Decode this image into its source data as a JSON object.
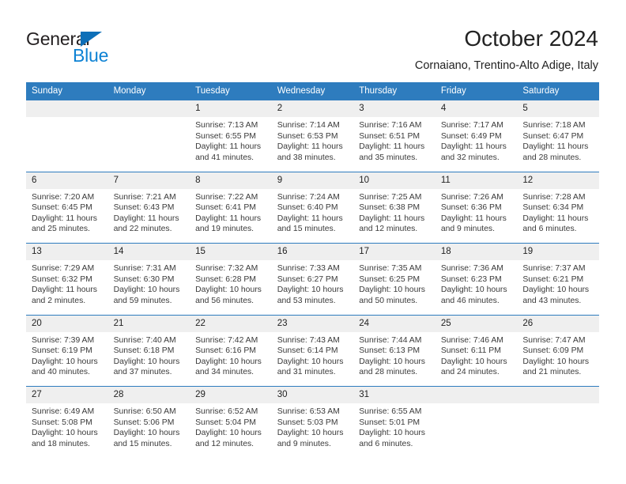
{
  "brand": {
    "name_part1": "General",
    "name_part2": "Blue",
    "accent_color": "#0d82d4",
    "triangle_color": "#0d6fb8"
  },
  "header": {
    "title": "October 2024",
    "subtitle": "Cornaiano, Trentino-Alto Adige, Italy",
    "header_bg": "#2e7cbe",
    "daynum_bg": "#efefef"
  },
  "weekday_headers": [
    "Sunday",
    "Monday",
    "Tuesday",
    "Wednesday",
    "Thursday",
    "Friday",
    "Saturday"
  ],
  "labels": {
    "sunrise_prefix": "Sunrise:",
    "sunset_prefix": "Sunset:",
    "daylight_prefix": "Daylight:"
  },
  "weeks": [
    [
      {
        "day": "",
        "empty": true
      },
      {
        "day": "",
        "empty": true
      },
      {
        "day": "1",
        "sunrise": "Sunrise: 7:13 AM",
        "sunset": "Sunset: 6:55 PM",
        "daylight_l1": "Daylight: 11 hours",
        "daylight_l2": "and 41 minutes."
      },
      {
        "day": "2",
        "sunrise": "Sunrise: 7:14 AM",
        "sunset": "Sunset: 6:53 PM",
        "daylight_l1": "Daylight: 11 hours",
        "daylight_l2": "and 38 minutes."
      },
      {
        "day": "3",
        "sunrise": "Sunrise: 7:16 AM",
        "sunset": "Sunset: 6:51 PM",
        "daylight_l1": "Daylight: 11 hours",
        "daylight_l2": "and 35 minutes."
      },
      {
        "day": "4",
        "sunrise": "Sunrise: 7:17 AM",
        "sunset": "Sunset: 6:49 PM",
        "daylight_l1": "Daylight: 11 hours",
        "daylight_l2": "and 32 minutes."
      },
      {
        "day": "5",
        "sunrise": "Sunrise: 7:18 AM",
        "sunset": "Sunset: 6:47 PM",
        "daylight_l1": "Daylight: 11 hours",
        "daylight_l2": "and 28 minutes."
      }
    ],
    [
      {
        "day": "6",
        "sunrise": "Sunrise: 7:20 AM",
        "sunset": "Sunset: 6:45 PM",
        "daylight_l1": "Daylight: 11 hours",
        "daylight_l2": "and 25 minutes."
      },
      {
        "day": "7",
        "sunrise": "Sunrise: 7:21 AM",
        "sunset": "Sunset: 6:43 PM",
        "daylight_l1": "Daylight: 11 hours",
        "daylight_l2": "and 22 minutes."
      },
      {
        "day": "8",
        "sunrise": "Sunrise: 7:22 AM",
        "sunset": "Sunset: 6:41 PM",
        "daylight_l1": "Daylight: 11 hours",
        "daylight_l2": "and 19 minutes."
      },
      {
        "day": "9",
        "sunrise": "Sunrise: 7:24 AM",
        "sunset": "Sunset: 6:40 PM",
        "daylight_l1": "Daylight: 11 hours",
        "daylight_l2": "and 15 minutes."
      },
      {
        "day": "10",
        "sunrise": "Sunrise: 7:25 AM",
        "sunset": "Sunset: 6:38 PM",
        "daylight_l1": "Daylight: 11 hours",
        "daylight_l2": "and 12 minutes."
      },
      {
        "day": "11",
        "sunrise": "Sunrise: 7:26 AM",
        "sunset": "Sunset: 6:36 PM",
        "daylight_l1": "Daylight: 11 hours",
        "daylight_l2": "and 9 minutes."
      },
      {
        "day": "12",
        "sunrise": "Sunrise: 7:28 AM",
        "sunset": "Sunset: 6:34 PM",
        "daylight_l1": "Daylight: 11 hours",
        "daylight_l2": "and 6 minutes."
      }
    ],
    [
      {
        "day": "13",
        "sunrise": "Sunrise: 7:29 AM",
        "sunset": "Sunset: 6:32 PM",
        "daylight_l1": "Daylight: 11 hours",
        "daylight_l2": "and 2 minutes."
      },
      {
        "day": "14",
        "sunrise": "Sunrise: 7:31 AM",
        "sunset": "Sunset: 6:30 PM",
        "daylight_l1": "Daylight: 10 hours",
        "daylight_l2": "and 59 minutes."
      },
      {
        "day": "15",
        "sunrise": "Sunrise: 7:32 AM",
        "sunset": "Sunset: 6:28 PM",
        "daylight_l1": "Daylight: 10 hours",
        "daylight_l2": "and 56 minutes."
      },
      {
        "day": "16",
        "sunrise": "Sunrise: 7:33 AM",
        "sunset": "Sunset: 6:27 PM",
        "daylight_l1": "Daylight: 10 hours",
        "daylight_l2": "and 53 minutes."
      },
      {
        "day": "17",
        "sunrise": "Sunrise: 7:35 AM",
        "sunset": "Sunset: 6:25 PM",
        "daylight_l1": "Daylight: 10 hours",
        "daylight_l2": "and 50 minutes."
      },
      {
        "day": "18",
        "sunrise": "Sunrise: 7:36 AM",
        "sunset": "Sunset: 6:23 PM",
        "daylight_l1": "Daylight: 10 hours",
        "daylight_l2": "and 46 minutes."
      },
      {
        "day": "19",
        "sunrise": "Sunrise: 7:37 AM",
        "sunset": "Sunset: 6:21 PM",
        "daylight_l1": "Daylight: 10 hours",
        "daylight_l2": "and 43 minutes."
      }
    ],
    [
      {
        "day": "20",
        "sunrise": "Sunrise: 7:39 AM",
        "sunset": "Sunset: 6:19 PM",
        "daylight_l1": "Daylight: 10 hours",
        "daylight_l2": "and 40 minutes."
      },
      {
        "day": "21",
        "sunrise": "Sunrise: 7:40 AM",
        "sunset": "Sunset: 6:18 PM",
        "daylight_l1": "Daylight: 10 hours",
        "daylight_l2": "and 37 minutes."
      },
      {
        "day": "22",
        "sunrise": "Sunrise: 7:42 AM",
        "sunset": "Sunset: 6:16 PM",
        "daylight_l1": "Daylight: 10 hours",
        "daylight_l2": "and 34 minutes."
      },
      {
        "day": "23",
        "sunrise": "Sunrise: 7:43 AM",
        "sunset": "Sunset: 6:14 PM",
        "daylight_l1": "Daylight: 10 hours",
        "daylight_l2": "and 31 minutes."
      },
      {
        "day": "24",
        "sunrise": "Sunrise: 7:44 AM",
        "sunset": "Sunset: 6:13 PM",
        "daylight_l1": "Daylight: 10 hours",
        "daylight_l2": "and 28 minutes."
      },
      {
        "day": "25",
        "sunrise": "Sunrise: 7:46 AM",
        "sunset": "Sunset: 6:11 PM",
        "daylight_l1": "Daylight: 10 hours",
        "daylight_l2": "and 24 minutes."
      },
      {
        "day": "26",
        "sunrise": "Sunrise: 7:47 AM",
        "sunset": "Sunset: 6:09 PM",
        "daylight_l1": "Daylight: 10 hours",
        "daylight_l2": "and 21 minutes."
      }
    ],
    [
      {
        "day": "27",
        "sunrise": "Sunrise: 6:49 AM",
        "sunset": "Sunset: 5:08 PM",
        "daylight_l1": "Daylight: 10 hours",
        "daylight_l2": "and 18 minutes."
      },
      {
        "day": "28",
        "sunrise": "Sunrise: 6:50 AM",
        "sunset": "Sunset: 5:06 PM",
        "daylight_l1": "Daylight: 10 hours",
        "daylight_l2": "and 15 minutes."
      },
      {
        "day": "29",
        "sunrise": "Sunrise: 6:52 AM",
        "sunset": "Sunset: 5:04 PM",
        "daylight_l1": "Daylight: 10 hours",
        "daylight_l2": "and 12 minutes."
      },
      {
        "day": "30",
        "sunrise": "Sunrise: 6:53 AM",
        "sunset": "Sunset: 5:03 PM",
        "daylight_l1": "Daylight: 10 hours",
        "daylight_l2": "and 9 minutes."
      },
      {
        "day": "31",
        "sunrise": "Sunrise: 6:55 AM",
        "sunset": "Sunset: 5:01 PM",
        "daylight_l1": "Daylight: 10 hours",
        "daylight_l2": "and 6 minutes."
      },
      {
        "day": "",
        "empty": true
      },
      {
        "day": "",
        "empty": true
      }
    ]
  ]
}
